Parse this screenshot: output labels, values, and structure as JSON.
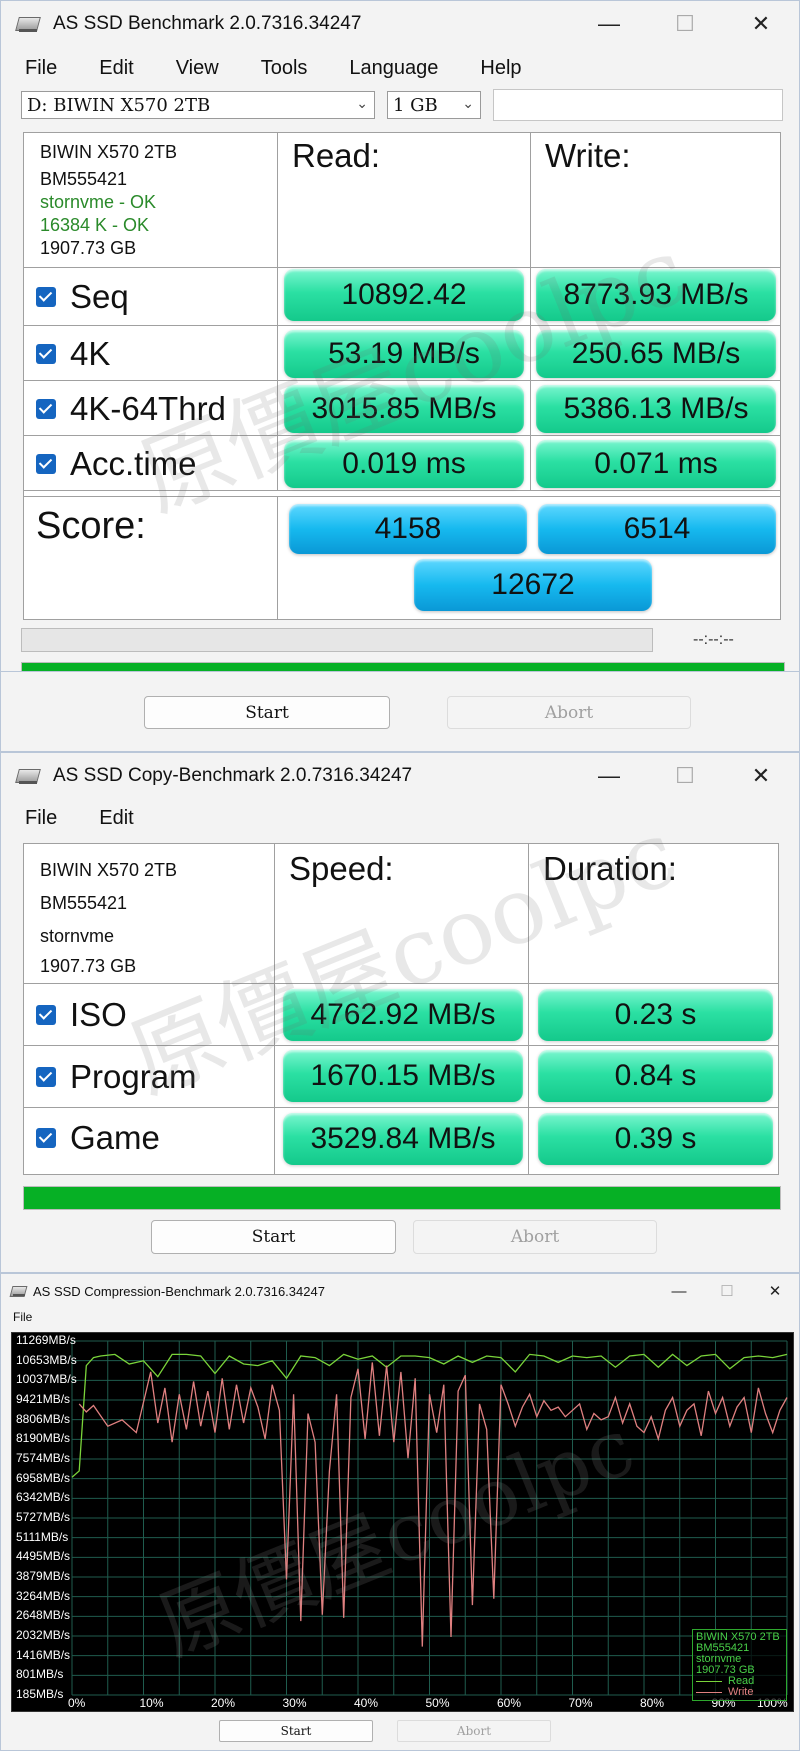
{
  "bench": {
    "title": "AS SSD Benchmark 2.0.7316.34247",
    "controls": {
      "minimize": "—",
      "maximize": "☐",
      "close": "✕"
    },
    "menu": [
      "File",
      "Edit",
      "View",
      "Tools",
      "Language",
      "Help"
    ],
    "drive_select": "D: BIWIN X570 2TB",
    "size_select": "1 GB",
    "info": [
      "BIWIN X570 2TB",
      "BM555421",
      "stornvme - OK",
      "16384 K - OK",
      "1907.73 GB"
    ],
    "read_header": "Read:",
    "write_header": "Write:",
    "rows": [
      {
        "label": "Seq",
        "read": "10892.42",
        "write": "8773.93 MB/s"
      },
      {
        "label": "4K",
        "read": "53.19 MB/s",
        "write": "250.65 MB/s"
      },
      {
        "label": "4K-64Thrd",
        "read": "3015.85 MB/s",
        "write": "5386.13 MB/s"
      },
      {
        "label": "Acc.time",
        "read": "0.019 ms",
        "write": "0.071 ms"
      }
    ],
    "score_label": "Score:",
    "score_read": "4158",
    "score_write": "6514",
    "score_total": "12672",
    "timer": "--:--:--",
    "start": "Start",
    "abort": "Abort"
  },
  "copy": {
    "title": "AS SSD Copy-Benchmark 2.0.7316.34247",
    "menu": [
      "File",
      "Edit"
    ],
    "info": [
      "BIWIN X570 2TB",
      "BM555421",
      "stornvme",
      "1907.73 GB"
    ],
    "speed_header": "Speed:",
    "duration_header": "Duration:",
    "rows": [
      {
        "label": "ISO",
        "speed": "4762.92 MB/s",
        "duration": "0.23 s"
      },
      {
        "label": "Program",
        "speed": "1670.15 MB/s",
        "duration": "0.84 s"
      },
      {
        "label": "Game",
        "speed": "3529.84 MB/s",
        "duration": "0.39 s"
      }
    ],
    "start": "Start",
    "abort": "Abort"
  },
  "compression": {
    "title": "AS SSD Compression-Benchmark 2.0.7316.34247",
    "menu": [
      "File"
    ],
    "start": "Start",
    "abort": "Abort"
  },
  "watermark_text": "原價屋coolpc",
  "colors": {
    "value_green": "#2be0a3",
    "score_blue": "#16b9ef",
    "progress_green": "#06b025",
    "read_line": "#7ad43a",
    "write_line": "#e08080"
  },
  "chart_data": {
    "type": "line",
    "title": "",
    "xlabel": "",
    "ylabel": "",
    "x_ticks": [
      "0%",
      "10%",
      "20%",
      "30%",
      "40%",
      "50%",
      "60%",
      "70%",
      "80%",
      "90%",
      "100%"
    ],
    "y_ticks": [
      "11269MB/s",
      "10653MB/s",
      "10037MB/s",
      "9421MB/s",
      "8806MB/s",
      "8190MB/s",
      "7574MB/s",
      "6958MB/s",
      "6342MB/s",
      "5727MB/s",
      "5111MB/s",
      "4495MB/s",
      "3879MB/s",
      "3264MB/s",
      "2648MB/s",
      "2032MB/s",
      "1416MB/s",
      "801MB/s",
      "185MB/s"
    ],
    "ylim": [
      185,
      11269
    ],
    "xlim": [
      0,
      100
    ],
    "grid": true,
    "legend_position": "bottom-right",
    "legend_info": [
      "BIWIN X570 2TB",
      "BM555421",
      "stornvme",
      "1907.73 GB"
    ],
    "series": [
      {
        "name": "Read",
        "color": "#7ad43a",
        "x": [
          0,
          1,
          2,
          3,
          4,
          6,
          8,
          10,
          12,
          14,
          16,
          18,
          20,
          22,
          24,
          26,
          28,
          30,
          32,
          34,
          36,
          38,
          40,
          42,
          44,
          46,
          48,
          50,
          52,
          54,
          56,
          58,
          60,
          62,
          64,
          66,
          68,
          70,
          72,
          74,
          76,
          78,
          80,
          82,
          84,
          86,
          88,
          90,
          92,
          94,
          96,
          98,
          100
        ],
        "y": [
          7000,
          7200,
          10500,
          10750,
          10800,
          10850,
          10550,
          10650,
          10150,
          10850,
          10850,
          10800,
          10250,
          10800,
          10550,
          10500,
          10650,
          10100,
          10800,
          10750,
          10500,
          10850,
          10700,
          10800,
          10450,
          10800,
          10800,
          10750,
          10550,
          10800,
          10600,
          10800,
          10750,
          10300,
          10850,
          10800,
          10600,
          10800,
          10750,
          10800,
          10450,
          10800,
          10850,
          10450,
          10850,
          10500,
          10800,
          10850,
          10400,
          10750,
          10800,
          10750,
          10850
        ]
      },
      {
        "name": "Write",
        "color": "#e08080",
        "x": [
          1,
          2,
          3,
          5,
          7,
          9,
          11,
          12,
          13,
          14,
          15,
          16,
          17,
          18,
          19,
          20,
          21,
          22,
          23,
          24,
          25,
          26,
          27,
          28,
          29,
          30,
          31,
          32,
          33,
          34,
          35,
          36,
          37,
          38,
          39,
          40,
          41,
          42,
          43,
          44,
          45,
          46,
          47,
          48,
          49,
          50,
          51,
          52,
          53,
          54,
          55,
          56,
          57,
          58,
          59,
          60,
          61,
          62,
          63,
          64,
          65,
          66,
          67,
          68,
          69,
          70,
          71,
          72,
          73,
          74,
          75,
          76,
          77,
          78,
          79,
          80,
          81,
          82,
          83,
          84,
          85,
          86,
          87,
          88,
          89,
          90,
          91,
          92,
          93,
          94,
          95,
          96,
          97,
          98,
          99,
          100
        ],
        "y": [
          9300,
          9050,
          9250,
          8600,
          8800,
          8400,
          10300,
          8700,
          9800,
          8100,
          9600,
          8500,
          10000,
          8600,
          9700,
          8400,
          10100,
          8500,
          9900,
          8700,
          9800,
          9200,
          8200,
          9900,
          9100,
          3800,
          9600,
          2500,
          9000,
          8100,
          2700,
          7200,
          9600,
          2600,
          9500,
          10400,
          8200,
          10600,
          8300,
          10500,
          8100,
          10300,
          7600,
          10100,
          1700,
          9600,
          8400,
          9900,
          2000,
          9700,
          10200,
          3000,
          9300,
          8500,
          3200,
          9900,
          9300,
          8600,
          9200,
          9600,
          8900,
          9400,
          9100,
          9200,
          8900,
          9100,
          9300,
          8500,
          9000,
          8800,
          8900,
          9500,
          8700,
          9300,
          8600,
          8400,
          8900,
          8200,
          9100,
          9500,
          8600,
          9100,
          9300,
          8300,
          9700,
          9000,
          9500,
          8600,
          9200,
          9500,
          8400,
          9800,
          9000,
          8400,
          9100,
          9500
        ]
      }
    ]
  }
}
